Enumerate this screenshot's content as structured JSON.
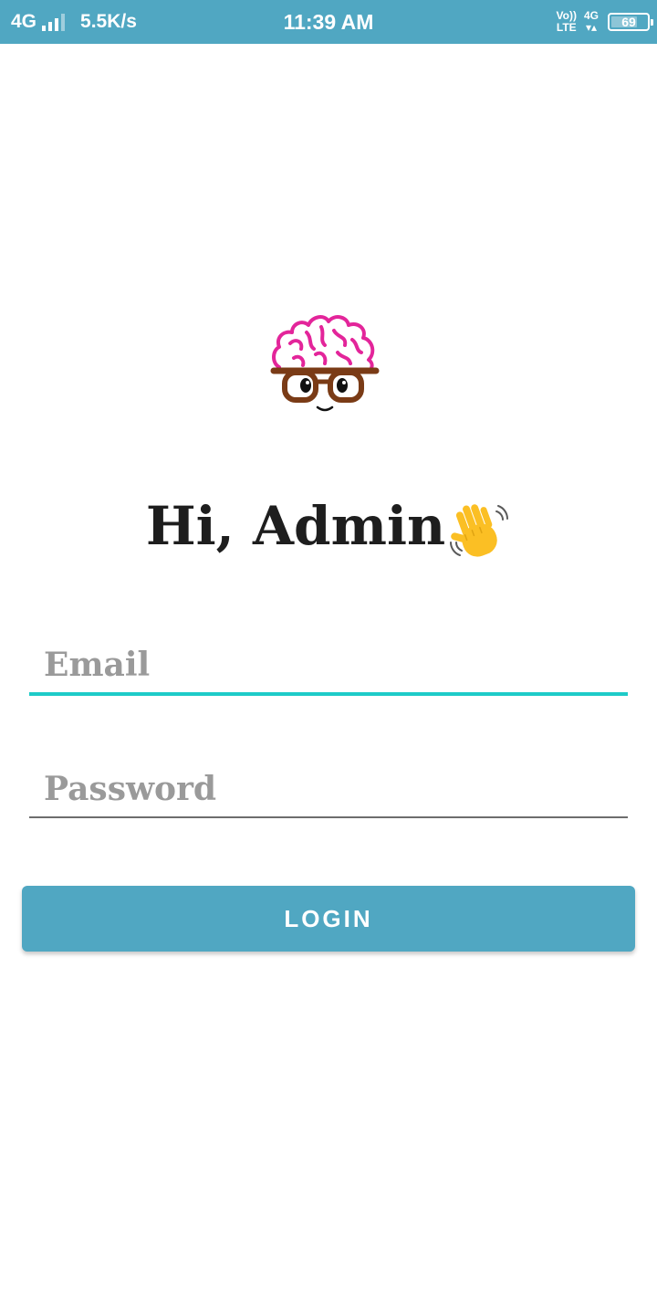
{
  "status_bar": {
    "network": "4G",
    "speed": "5.5K/s",
    "time": "11:39 AM",
    "volte_top": "Vo))",
    "volte_bottom": "LTE",
    "net_type": "4G",
    "battery": "69",
    "background_color": "#50a7c2"
  },
  "logo": {
    "icon": "brain-with-glasses-icon"
  },
  "greeting": {
    "text": "Hi, Admin",
    "emoji": "waving-hand-icon"
  },
  "form": {
    "email_placeholder": "Email",
    "email_value": "",
    "password_placeholder": "Password",
    "password_value": "",
    "active_underline_color": "#1ecbc8"
  },
  "login_button": {
    "label": "LOGIN",
    "color": "#50a7c2"
  }
}
